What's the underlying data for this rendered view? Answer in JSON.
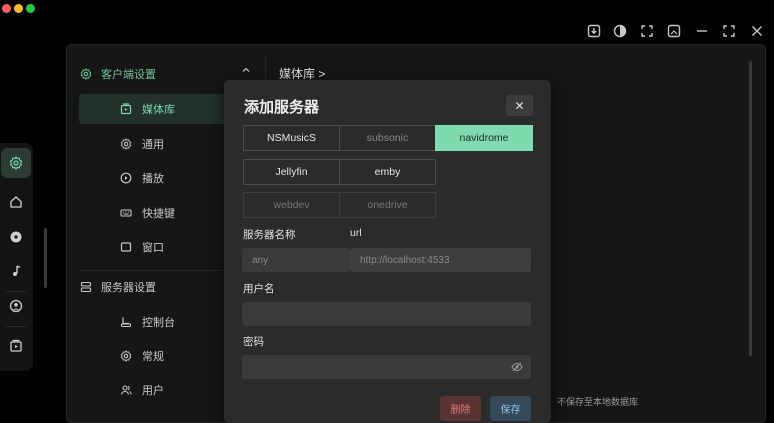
{
  "window": {
    "controls": [
      "download-icon",
      "contrast-icon",
      "fullscreen-icon",
      "picture-icon",
      "minimize-icon",
      "maximize-icon",
      "close-icon"
    ]
  },
  "rail": {
    "items": [
      "gear-icon",
      "home-icon",
      "disc-icon",
      "music-note-icon",
      "user-circle-icon",
      "playlist-icon"
    ]
  },
  "nav": {
    "client_settings": "客户端设置",
    "client_items": [
      {
        "label": "媒体库",
        "icon": "library-icon"
      },
      {
        "label": "通用",
        "icon": "gear-icon"
      },
      {
        "label": "播放",
        "icon": "play-icon"
      },
      {
        "label": "快捷键",
        "icon": "keyboard-icon"
      },
      {
        "label": "窗口",
        "icon": "window-icon"
      }
    ],
    "server_settings": "服务器设置",
    "server_items": [
      {
        "label": "控制台",
        "icon": "console-icon"
      },
      {
        "label": "常规",
        "icon": "gear-icon"
      },
      {
        "label": "用户",
        "icon": "users-icon"
      }
    ]
  },
  "main": {
    "breadcrumb": "媒体库 >",
    "hint": "不保存至本地数据库"
  },
  "modal": {
    "title": "添加服务器",
    "server_types_row1": [
      "NSMusicS",
      "subsonic",
      "navidrome"
    ],
    "server_types_row2": [
      "Jellyfin",
      "emby"
    ],
    "server_types_row3": [
      "webdev",
      "onedrive"
    ],
    "selected_type": "navidrome",
    "server_name_label": "服务器名称",
    "url_label": "url",
    "server_name_placeholder": "any",
    "url_placeholder": "http://localhost:4533",
    "username_label": "用户名",
    "password_label": "密码",
    "delete_label": "删除",
    "save_label": "保存"
  },
  "colors": {
    "accent": "#7fdab0",
    "delete": "#e07a7a",
    "save": "#8fc7ec"
  }
}
